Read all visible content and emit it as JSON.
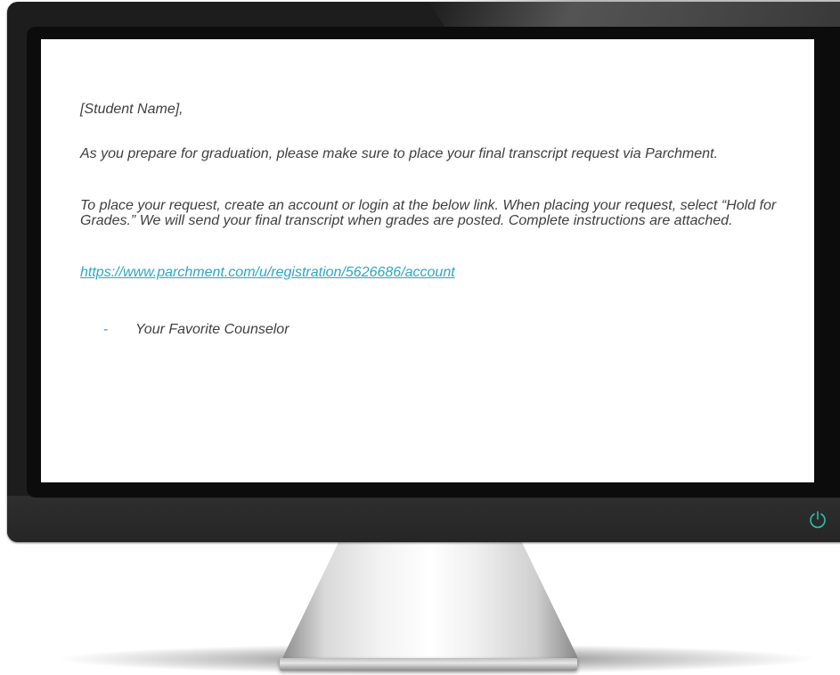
{
  "email": {
    "greeting": "[Student Name],",
    "paragraph1": "As you prepare for graduation, please make sure to place your final transcript request via Parchment.",
    "paragraph2": "To place your request, create an account or login at the below link. When placing your request, select “Hold for Grades.” We will send your final transcript when grades are posted. Complete instructions are attached.",
    "link": "https://www.parchment.com/u/registration/5626686/account",
    "signoff_bullet": "-",
    "signoff": "Your Favorite Counselor"
  },
  "monitor": {
    "power_icon": "power-icon",
    "power_color": "#2bbfa6"
  }
}
